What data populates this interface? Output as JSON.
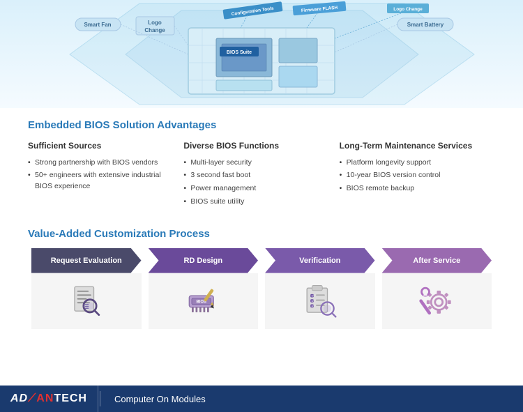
{
  "diagram": {
    "labels": {
      "smart_fan": "Smart Fan",
      "logo_change": "Logo\nChange",
      "bios_suite": "BIOS Suite",
      "config_tools": "Configuration Tools",
      "firmware_flash": "Firmware FLASH",
      "logo_change_top": "Logo Change",
      "smart_battery": "Smart Battery"
    }
  },
  "content": {
    "section_title": "Embedded BIOS Solution Advantages",
    "columns": [
      {
        "title": "Sufficient Sources",
        "bullets": [
          "Strong partnership with BIOS vendors",
          "50+ engineers with extensive industrial BIOS experience"
        ]
      },
      {
        "title": "Diverse BIOS Functions",
        "bullets": [
          "Multi-layer security",
          "3 second fast boot",
          "Power management",
          "BIOS suite utility"
        ]
      },
      {
        "title": "Long-Term Maintenance Services",
        "bullets": [
          "Platform longevity support",
          "10-year BIOS version control",
          "BIOS remote backup"
        ]
      }
    ]
  },
  "process": {
    "title": "Value-Added Customization Process",
    "steps": [
      {
        "id": 1,
        "label": "Request Evaluation",
        "icon": "search-doc-icon"
      },
      {
        "id": 2,
        "label": "RD Design",
        "icon": "bios-chip-icon"
      },
      {
        "id": 3,
        "label": "Verification",
        "icon": "checklist-search-icon"
      },
      {
        "id": 4,
        "label": "After Service",
        "icon": "wrench-gear-icon"
      }
    ]
  },
  "footer": {
    "brand": "AD⧸ANTECH",
    "brand_ad": "AD",
    "brand_van": "⧸AN",
    "brand_tech": "TECH",
    "subtitle": "Computer On Modules"
  }
}
